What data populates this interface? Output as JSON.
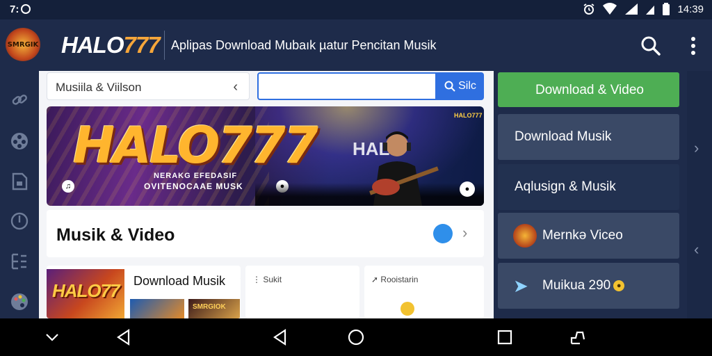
{
  "status_bar": {
    "left_text": "7:",
    "time": "14:39"
  },
  "app_bar": {
    "logo_text": "SMRGIK",
    "brand_prefix": "HALO",
    "brand_accent": "777",
    "title": "Aplipas Download Mubaık µatur Pencitan Musik"
  },
  "side_rail": {
    "icons": [
      "link-icon",
      "film-reel-icon",
      "document-icon",
      "compass-icon",
      "list-icon",
      "palette-icon"
    ]
  },
  "filter": {
    "select_value": "Musiila & Viilson",
    "search_placeholder": "",
    "search_button_label": "Silc"
  },
  "banner": {
    "headline": "HALO777",
    "line1": "NERAKG EFEDASIF",
    "line2": "OVITENOCAAE MUSK",
    "overlay_text": "HAL",
    "corner_logo": "HALO777"
  },
  "section": {
    "title": "Musik & Video"
  },
  "cards": [
    {
      "thumb_text": "HALO77",
      "title": "Download Musik",
      "sub_thumb_text": "SMRGIOK"
    },
    {
      "label": "Sukit"
    },
    {
      "label": "Rooistarin"
    }
  ],
  "right_menu": {
    "items": [
      {
        "label": "Download & Video",
        "icon": null
      },
      {
        "label": "Download Musik",
        "icon": null
      },
      {
        "label": "Aqlusign & Musik",
        "icon": null
      },
      {
        "label": "Mernkə Viceo",
        "icon": "disc-logo-icon"
      },
      {
        "label": "Muikua 290",
        "icon": "share-arrow-icon"
      }
    ]
  },
  "colors": {
    "app_bg": "#1b2846",
    "accent_blue": "#2f6fe0",
    "accent_green": "#4eae54",
    "brand_orange": "#f6a63a",
    "menu_item_bg": "#3a4966"
  }
}
